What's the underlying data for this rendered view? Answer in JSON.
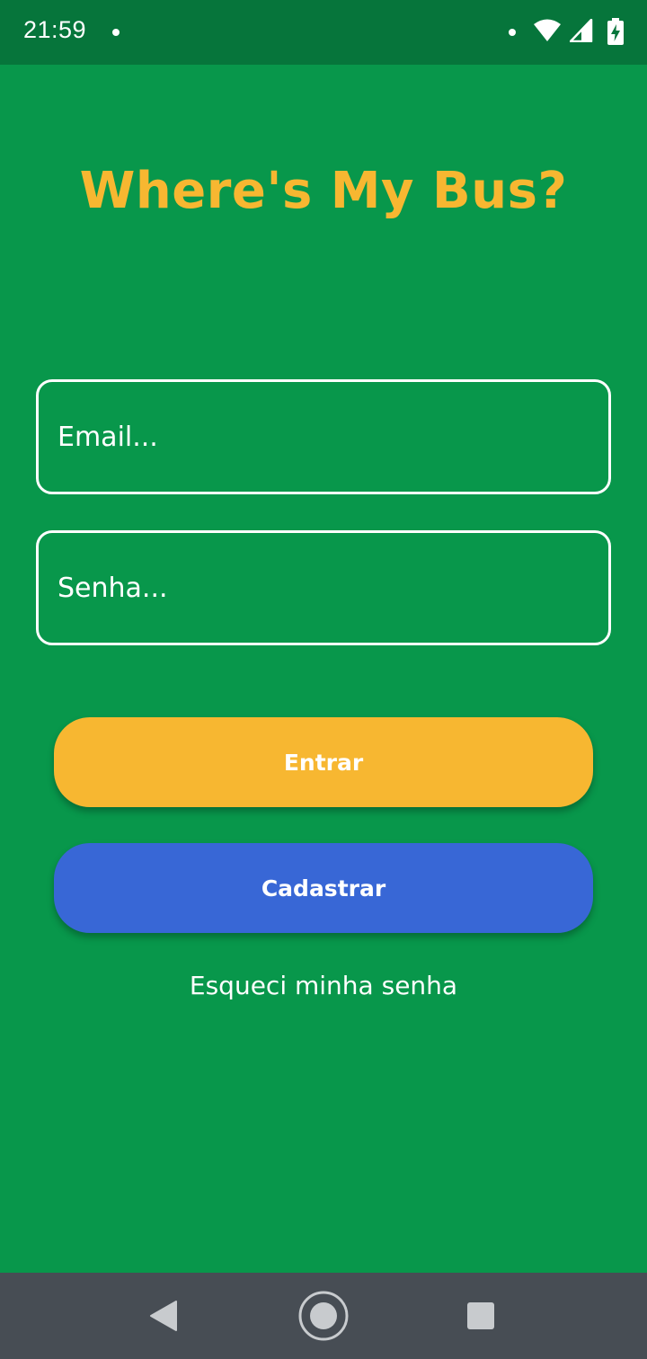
{
  "status_bar": {
    "time": "21:59",
    "icons": [
      "notification-dot",
      "wifi-icon",
      "signal-icon",
      "battery-charging-icon"
    ]
  },
  "app": {
    "title": "Where's My Bus?"
  },
  "form": {
    "email_placeholder": "Email...",
    "email_value": "",
    "password_placeholder": "Senha...",
    "password_value": ""
  },
  "buttons": {
    "login_label": "Entrar",
    "register_label": "Cadastrar"
  },
  "links": {
    "forgot_password": "Esqueci minha senha"
  },
  "nav_bar": {
    "icons": [
      "back-icon",
      "home-icon",
      "recents-icon"
    ]
  },
  "colors": {
    "background": "#08974b",
    "status_bar": "#06753b",
    "title": "#f7b731",
    "login_button": "#f7b731",
    "register_button": "#3867d6",
    "nav_bar": "#474d54"
  }
}
